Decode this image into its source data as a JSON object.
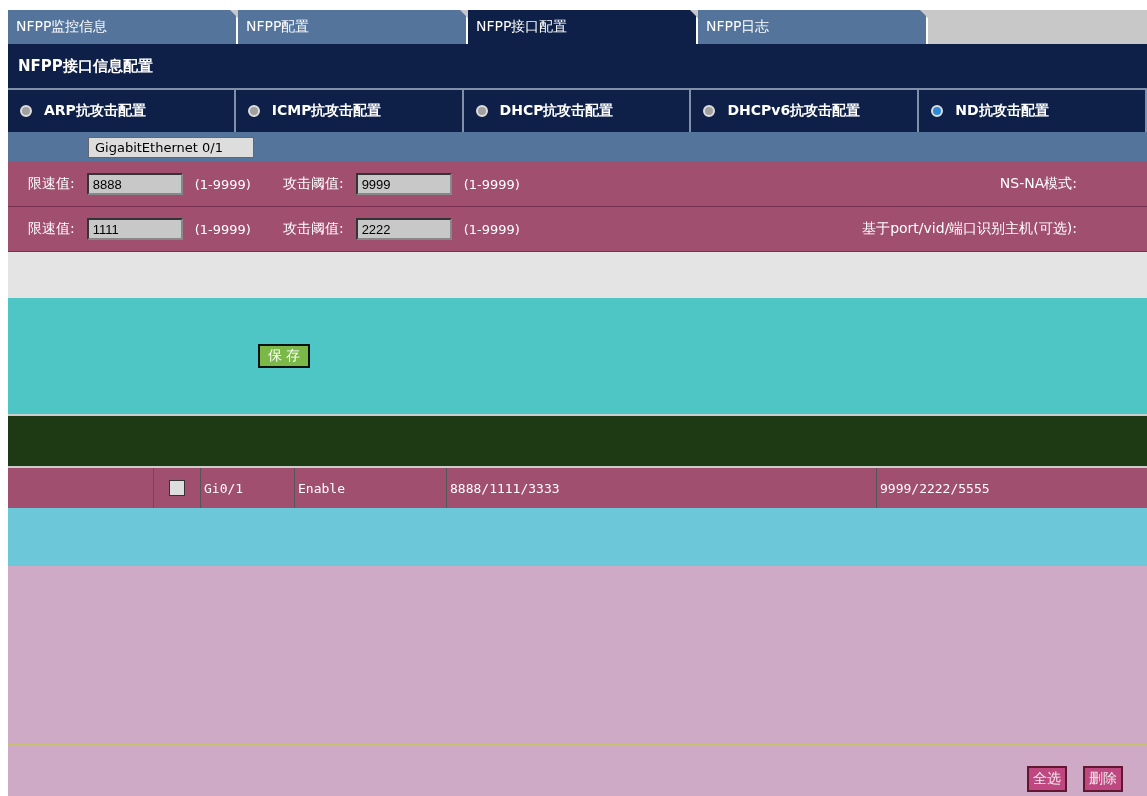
{
  "tabs": [
    {
      "label": "NFPP监控信息",
      "selected": false
    },
    {
      "label": "NFPP配置",
      "selected": false
    },
    {
      "label": "NFPP接口配置",
      "selected": true
    },
    {
      "label": "NFPP日志",
      "selected": false
    }
  ],
  "panel_title": "NFPP接口信息配置",
  "attack_types": [
    {
      "label": "ARP抗攻击配置",
      "selected": false
    },
    {
      "label": "ICMP抗攻击配置",
      "selected": false
    },
    {
      "label": "DHCP抗攻击配置",
      "selected": false
    },
    {
      "label": "DHCPv6抗攻击配置",
      "selected": false
    },
    {
      "label": "ND抗攻击配置",
      "selected": true
    }
  ],
  "port_select": {
    "value": "GigabitEthernet 0/1"
  },
  "rate_rows": [
    {
      "rate_label": "限速值:",
      "rate": "8888",
      "rate_range": "(1-9999)",
      "threshold_label": "攻击阈值:",
      "threshold": "9999",
      "threshold_range": "(1-9999)",
      "side_label": "NS-NA模式:"
    },
    {
      "rate_label": "限速值:",
      "rate": "1111",
      "rate_range": "(1-9999)",
      "threshold_label": "攻击阈值:",
      "threshold": "2222",
      "threshold_range": "(1-9999)",
      "side_label": "基于port/vid/端口识别主机(可选):"
    }
  ],
  "save_button": "保 存",
  "table": {
    "rows": [
      {
        "checked": false,
        "cells": [
          "Gi0/1",
          "Enable",
          "8888/1111/3333",
          "9999/2222/5555"
        ]
      }
    ]
  },
  "buttons": [
    "全选",
    "删除"
  ]
}
